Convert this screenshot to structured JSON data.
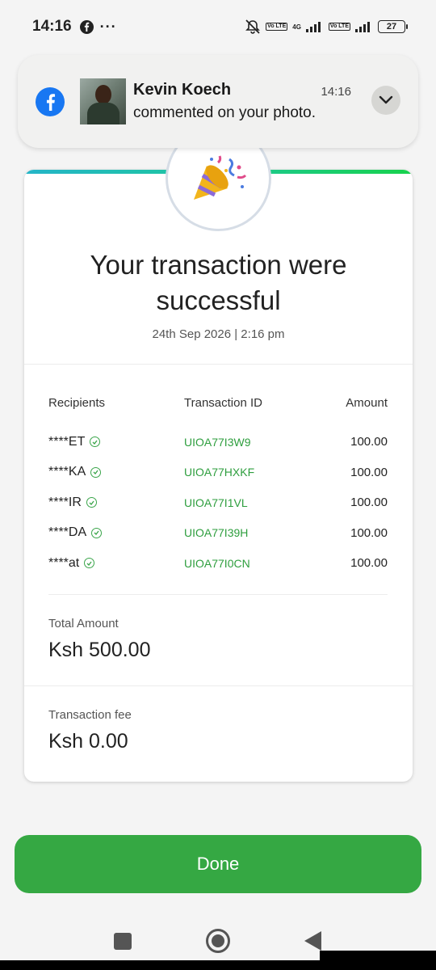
{
  "status_bar": {
    "time": "14:16",
    "more": "···",
    "volte1": "Vo LTE",
    "network": "4G",
    "volte2": "Vo LTE",
    "battery": "27"
  },
  "notification": {
    "app_icon": "facebook-icon",
    "sender": "Kevin Koech",
    "message": "commented on your photo.",
    "time": "14:16",
    "expand_icon": "chevron-down-icon"
  },
  "receipt": {
    "badge_icon": "party-popper-icon",
    "headline": "Your transaction were successful",
    "date": "24th Sep 2026 | 2:16 pm",
    "columns": [
      "Recipients",
      "Transaction ID",
      "Amount"
    ],
    "rows": [
      {
        "recipient": "****ET",
        "txid": "UIOA77I3W9",
        "amount": "100.00"
      },
      {
        "recipient": "****KA",
        "txid": "UIOA77HXKF",
        "amount": "100.00"
      },
      {
        "recipient": "****IR",
        "txid": "UIOA77I1VL",
        "amount": "100.00"
      },
      {
        "recipient": "****DA",
        "txid": "UIOA77I39H",
        "amount": "100.00"
      },
      {
        "recipient": "****at",
        "txid": "UIOA77I0CN",
        "amount": "100.00"
      }
    ],
    "total_label": "Total Amount",
    "total_value": "Ksh 500.00",
    "fee_label": "Transaction fee",
    "fee_value": "Ksh 0.00"
  },
  "actions": {
    "done_label": "Done"
  },
  "colors": {
    "accent_green": "#35a843",
    "txid_green": "#2e9e3e",
    "facebook_blue": "#1877f2"
  }
}
